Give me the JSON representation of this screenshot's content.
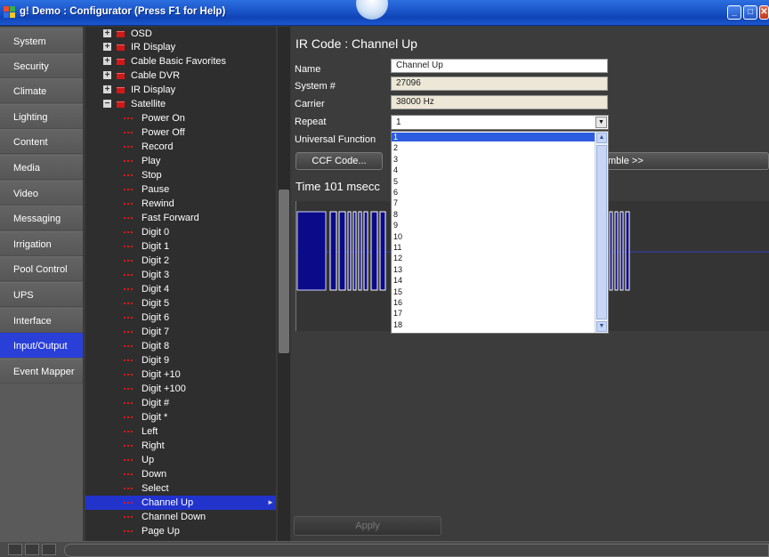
{
  "window": {
    "title": "g! Demo : Configurator  (Press F1 for Help)",
    "icons": [
      "app-icon",
      "minimize-icon",
      "maximize-icon",
      "close-icon"
    ]
  },
  "nav": {
    "items": [
      {
        "label": "System"
      },
      {
        "label": "Security"
      },
      {
        "label": "Climate"
      },
      {
        "label": "Lighting"
      },
      {
        "label": "Content"
      },
      {
        "label": "Media"
      },
      {
        "label": "Video"
      },
      {
        "label": "Messaging"
      },
      {
        "label": "Irrigation"
      },
      {
        "label": "Pool Control"
      },
      {
        "label": "UPS"
      },
      {
        "label": "Interface"
      },
      {
        "label": "Input/Output",
        "active": true
      },
      {
        "label": "Event Mapper"
      }
    ],
    "active_color": "#2a3fd8"
  },
  "tree": {
    "folders": [
      {
        "label": "OSD",
        "expander": "+"
      },
      {
        "label": "IR Display",
        "expander": "+"
      },
      {
        "label": "Cable Basic Favorites",
        "expander": "+"
      },
      {
        "label": "Cable DVR",
        "expander": "+"
      },
      {
        "label": "IR Display",
        "expander": "+"
      },
      {
        "label": "Satellite",
        "expander": "−"
      }
    ],
    "leaves": [
      "Power On",
      "Power Off",
      "Record",
      "Play",
      "Stop",
      "Pause",
      "Rewind",
      "Fast Forward",
      "Digit 0",
      "Digit 1",
      "Digit 2",
      "Digit 3",
      "Digit 4",
      "Digit 5",
      "Digit 6",
      "Digit 7",
      "Digit 8",
      "Digit 9",
      "Digit +10",
      "Digit +100",
      "Digit #",
      "Digit *",
      "Left",
      "Right",
      "Up",
      "Down",
      "Select",
      "Channel Up",
      "Channel Down",
      "Page Up"
    ],
    "selected": "Channel Up",
    "selected_color": "#2233cc"
  },
  "detail": {
    "heading": "IR Code : Channel Up",
    "name_label": "Name",
    "name_value": "Channel Up",
    "system_label": "System #",
    "system_value": "27096",
    "carrier_label": "Carrier",
    "carrier_value": "38000 Hz",
    "repeat_label": "Repeat",
    "repeat_value": "1",
    "universal_label": "Universal Function",
    "ccf_button": "CCF Code...",
    "assemble_button": "mble >>",
    "time_label": "Time 101 msecc",
    "apply_button": "Apply",
    "repeat_options": [
      "1",
      "2",
      "3",
      "4",
      "5",
      "6",
      "7",
      "8",
      "9",
      "10",
      "11",
      "12",
      "13",
      "14",
      "15",
      "16",
      "17",
      "18"
    ],
    "repeat_selected": "1",
    "waveform_color": "#0b0b8a"
  }
}
